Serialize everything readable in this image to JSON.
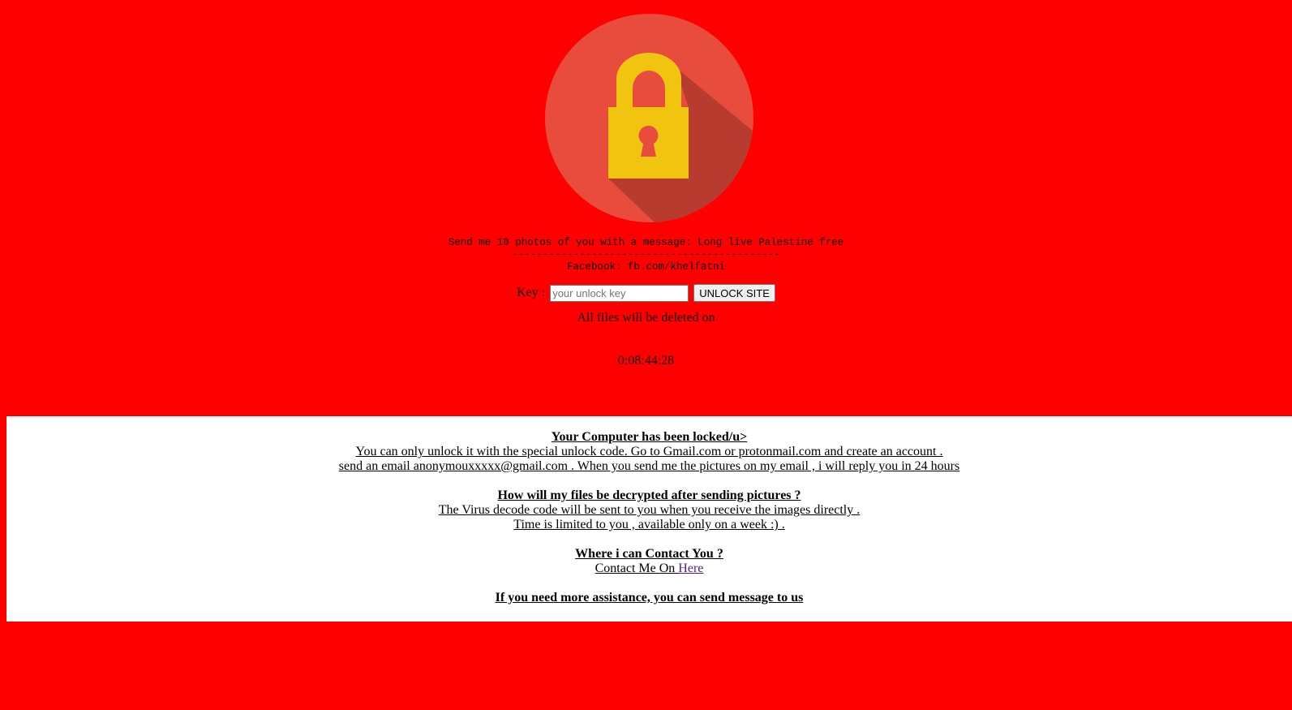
{
  "lock": {
    "circle_color": "#e74c3c",
    "shadow_color": "#b83b30",
    "lock_color": "#f1c40f",
    "keyhole_color": "#e74c3c"
  },
  "message": {
    "line1": "Send me 10 photos of you with a message: Long live Palestine free",
    "line2": "--------------------------------------------",
    "line3": "Facebook: fb.com/khelfatni"
  },
  "key_form": {
    "label": "Key :",
    "placeholder": "your unlock key",
    "button_label": "UNLOCK SITE"
  },
  "countdown": {
    "label": "All files will be deleted on",
    "time": "0:08:44:28"
  },
  "info": {
    "heading1": "Your Computer has been locked/u> ",
    "text1a": "You can only unlock it with the special unlock code. Go to Gmail.com or protonmail.com and create an account . ",
    "text1b": "send an email anonymouxxxxx@gmail.com . When you send me the pictures on my email , i will reply you in 24 hours ",
    "heading2": "How will my files be decrypted after sending pictures ? ",
    "text2a": "The Virus decode code will be sent to you when you receive the images directly . ",
    "text2b": "Time is limited to you , available only on a week :) . ",
    "heading3": "Where i can Contact You ? ",
    "contact_prefix": "Contact Me On ",
    "contact_link": "Here ",
    "heading4": "If you need more assistance, you can send message to us "
  },
  "colors": {
    "background": "#ff0000",
    "panel": "#ffffff",
    "link": "#551a8b"
  }
}
